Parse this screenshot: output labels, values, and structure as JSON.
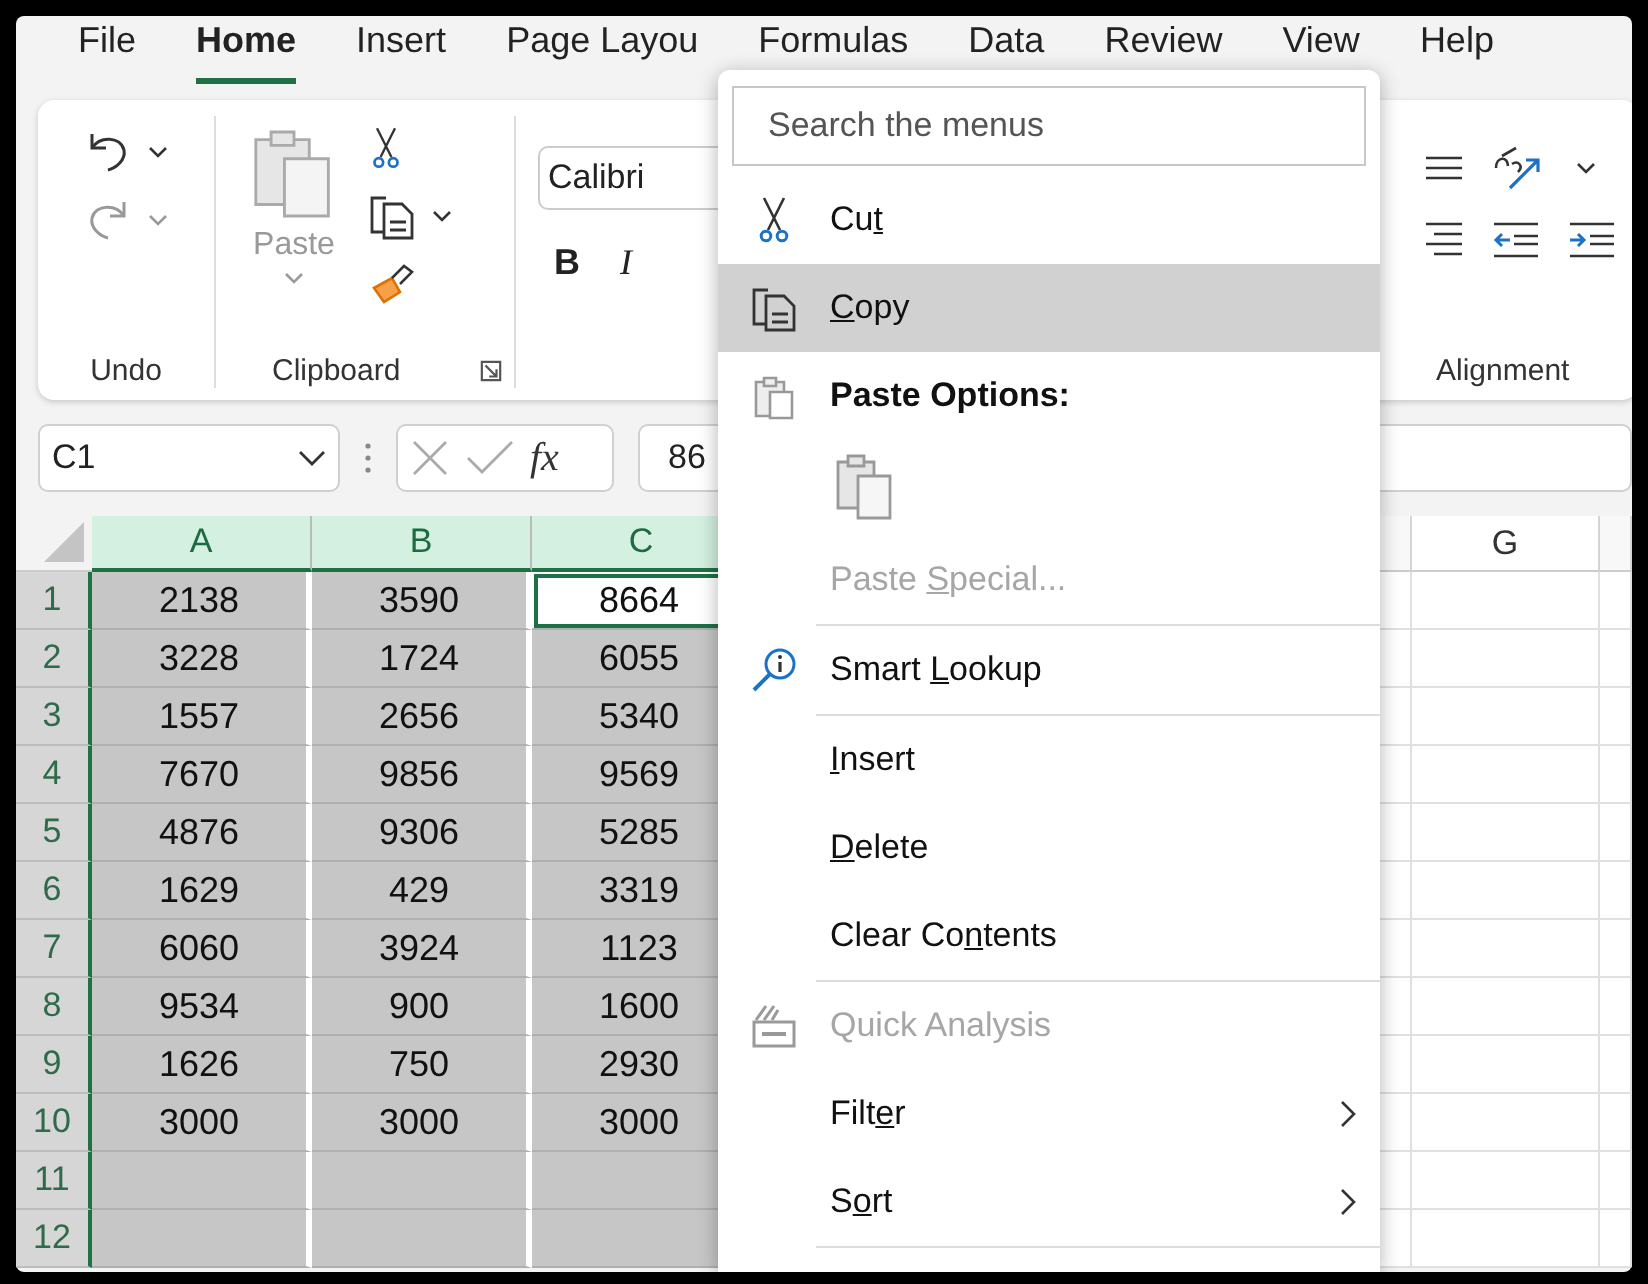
{
  "tabs": [
    {
      "label": "File",
      "selected": false
    },
    {
      "label": "Home",
      "selected": true
    },
    {
      "label": "Insert",
      "selected": false
    },
    {
      "label": "Page Layou",
      "selected": false
    },
    {
      "label": "Formulas",
      "selected": false
    },
    {
      "label": "Data",
      "selected": false
    },
    {
      "label": "Review",
      "selected": false
    },
    {
      "label": "View",
      "selected": false
    },
    {
      "label": "Help",
      "selected": false
    }
  ],
  "ribbon": {
    "undo_label": "Undo",
    "paste_label": "Paste",
    "clipboard_label": "Clipboard",
    "font_name": "Calibri",
    "bold_label": "B",
    "italic_label": "I",
    "alignment_label": "Alignment"
  },
  "formula_bar": {
    "name_box": "C1",
    "fx_label": "fx",
    "value": "86"
  },
  "grid": {
    "columns": [
      {
        "label": "A",
        "selected": true
      },
      {
        "label": "B",
        "selected": true
      },
      {
        "label": "C",
        "selected": true
      }
    ],
    "right_columns": [
      {
        "label": "G",
        "selected": false
      }
    ],
    "rows": [
      {
        "label": "1",
        "cells": [
          {
            "value": "2138",
            "active": false
          },
          {
            "value": "3590",
            "active": false
          },
          {
            "value": "8664",
            "active": true
          }
        ]
      },
      {
        "label": "2",
        "cells": [
          {
            "value": "3228",
            "active": false
          },
          {
            "value": "1724",
            "active": false
          },
          {
            "value": "6055",
            "active": false
          }
        ]
      },
      {
        "label": "3",
        "cells": [
          {
            "value": "1557",
            "active": false
          },
          {
            "value": "2656",
            "active": false
          },
          {
            "value": "5340",
            "active": false
          }
        ]
      },
      {
        "label": "4",
        "cells": [
          {
            "value": "7670",
            "active": false
          },
          {
            "value": "9856",
            "active": false
          },
          {
            "value": "9569",
            "active": false
          }
        ]
      },
      {
        "label": "5",
        "cells": [
          {
            "value": "4876",
            "active": false
          },
          {
            "value": "9306",
            "active": false
          },
          {
            "value": "5285",
            "active": false
          }
        ]
      },
      {
        "label": "6",
        "cells": [
          {
            "value": "1629",
            "active": false
          },
          {
            "value": "429",
            "active": false
          },
          {
            "value": "3319",
            "active": false
          }
        ]
      },
      {
        "label": "7",
        "cells": [
          {
            "value": "6060",
            "active": false
          },
          {
            "value": "3924",
            "active": false
          },
          {
            "value": "1123",
            "active": false
          }
        ]
      },
      {
        "label": "8",
        "cells": [
          {
            "value": "9534",
            "active": false
          },
          {
            "value": "900",
            "active": false
          },
          {
            "value": "1600",
            "active": false
          }
        ]
      },
      {
        "label": "9",
        "cells": [
          {
            "value": "1626",
            "active": false
          },
          {
            "value": "750",
            "active": false
          },
          {
            "value": "2930",
            "active": false
          }
        ]
      },
      {
        "label": "10",
        "cells": [
          {
            "value": "3000",
            "active": false
          },
          {
            "value": "3000",
            "active": false
          },
          {
            "value": "3000",
            "active": false
          }
        ]
      },
      {
        "label": "11",
        "cells": [
          {
            "active": false
          },
          {
            "active": false
          },
          {
            "active": false
          }
        ]
      },
      {
        "label": "12",
        "cells": [
          {
            "active": false
          },
          {
            "active": false
          },
          {
            "active": false
          }
        ]
      }
    ]
  },
  "context_menu": {
    "search_placeholder": "Search the menus",
    "items": [
      {
        "kind": "command",
        "label": {
          "pre": "Cu",
          "key": "t"
        },
        "highlighted": false,
        "disabled": false,
        "submenu": false
      },
      {
        "kind": "command",
        "label": {
          "key": "C",
          "post": "opy"
        },
        "highlighted": true,
        "disabled": false,
        "submenu": false
      },
      {
        "kind": "header",
        "text": "Paste Options:"
      },
      {
        "kind": "paste_options"
      },
      {
        "kind": "command",
        "label": {
          "pre": "Paste ",
          "key": "S",
          "post": "pecial..."
        },
        "highlighted": false,
        "disabled": true,
        "submenu": false
      },
      {
        "kind": "divider"
      },
      {
        "kind": "command",
        "label": {
          "pre": "Smart ",
          "key": "L",
          "post": "ookup"
        },
        "highlighted": false,
        "disabled": false,
        "submenu": false
      },
      {
        "kind": "divider"
      },
      {
        "kind": "command",
        "label": {
          "key": "I",
          "post": "nsert"
        },
        "highlighted": false,
        "disabled": false,
        "submenu": false
      },
      {
        "kind": "command",
        "label": {
          "key": "D",
          "post": "elete"
        },
        "highlighted": false,
        "disabled": false,
        "submenu": false
      },
      {
        "kind": "command",
        "label": {
          "pre": "Clear Co",
          "key": "n",
          "post": "tents"
        },
        "highlighted": false,
        "disabled": false,
        "submenu": false
      },
      {
        "kind": "divider"
      },
      {
        "kind": "command",
        "label": {
          "pre": "Quick Analysis"
        },
        "highlighted": false,
        "disabled": true,
        "submenu": false
      },
      {
        "kind": "command",
        "label": {
          "pre": "Filt",
          "key": "e",
          "post": "r"
        },
        "highlighted": false,
        "disabled": false,
        "submenu": true
      },
      {
        "kind": "command",
        "label": {
          "pre": "S",
          "key": "o",
          "post": "rt"
        },
        "highlighted": false,
        "disabled": false,
        "submenu": true
      },
      {
        "kind": "divider"
      }
    ]
  }
}
